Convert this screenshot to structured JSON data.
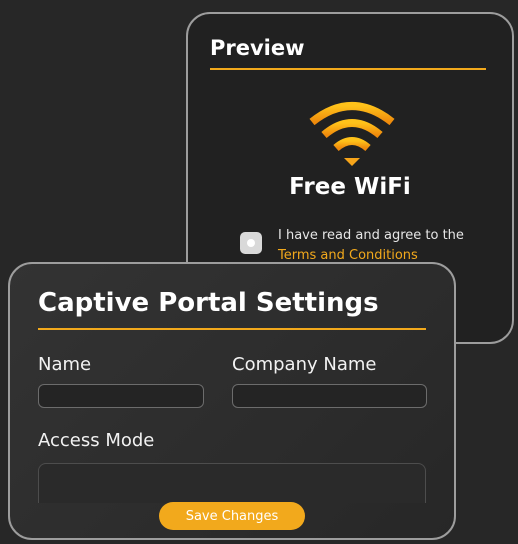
{
  "preview": {
    "title": "Preview",
    "wifi_icon": "wifi-icon",
    "headline": "Free WiFi",
    "agree_text": "I have read and agree to the",
    "terms_link": "Terms and Conditions"
  },
  "settings": {
    "title": "Captive Portal Settings",
    "name_label": "Name",
    "name_value": "",
    "company_label": "Company Name",
    "company_value": "",
    "access_mode_label": "Access Mode",
    "access_mode_value": "",
    "save_label": "Save Changes"
  },
  "colors": {
    "accent": "#f2a91c",
    "background": "#272727",
    "border": "#9d9d9d"
  }
}
